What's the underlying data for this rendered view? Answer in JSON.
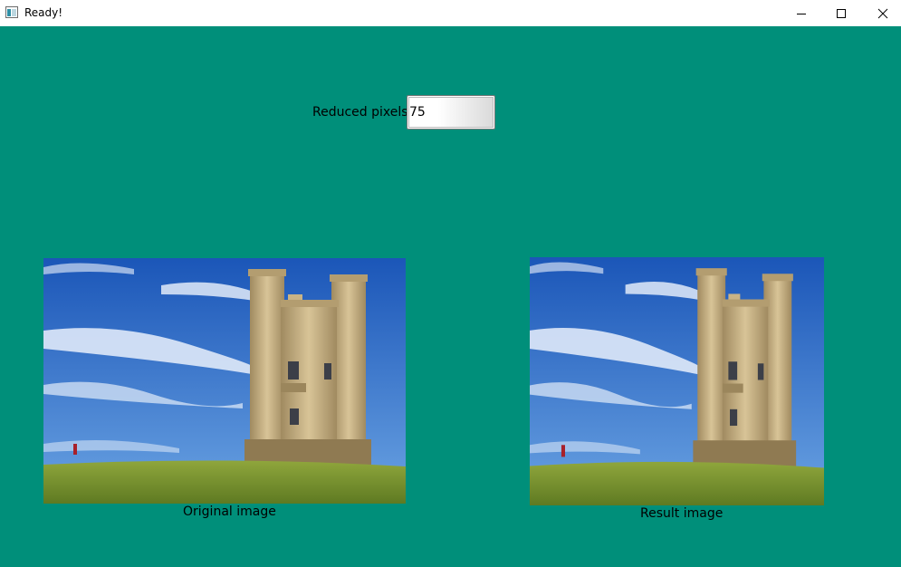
{
  "window": {
    "title": "Ready!",
    "controls": [
      "minimize-icon",
      "maximize-icon",
      "close-icon"
    ]
  },
  "form": {
    "reduce_label": "Reduced pixels:",
    "reduce_value": "75"
  },
  "images": {
    "original_caption": "Original image",
    "result_caption": "Result image"
  },
  "colors": {
    "background": "#008f7a",
    "titlebar": "#ffffff",
    "sky": "#2a67c4",
    "grass": "#6e8c2c"
  }
}
